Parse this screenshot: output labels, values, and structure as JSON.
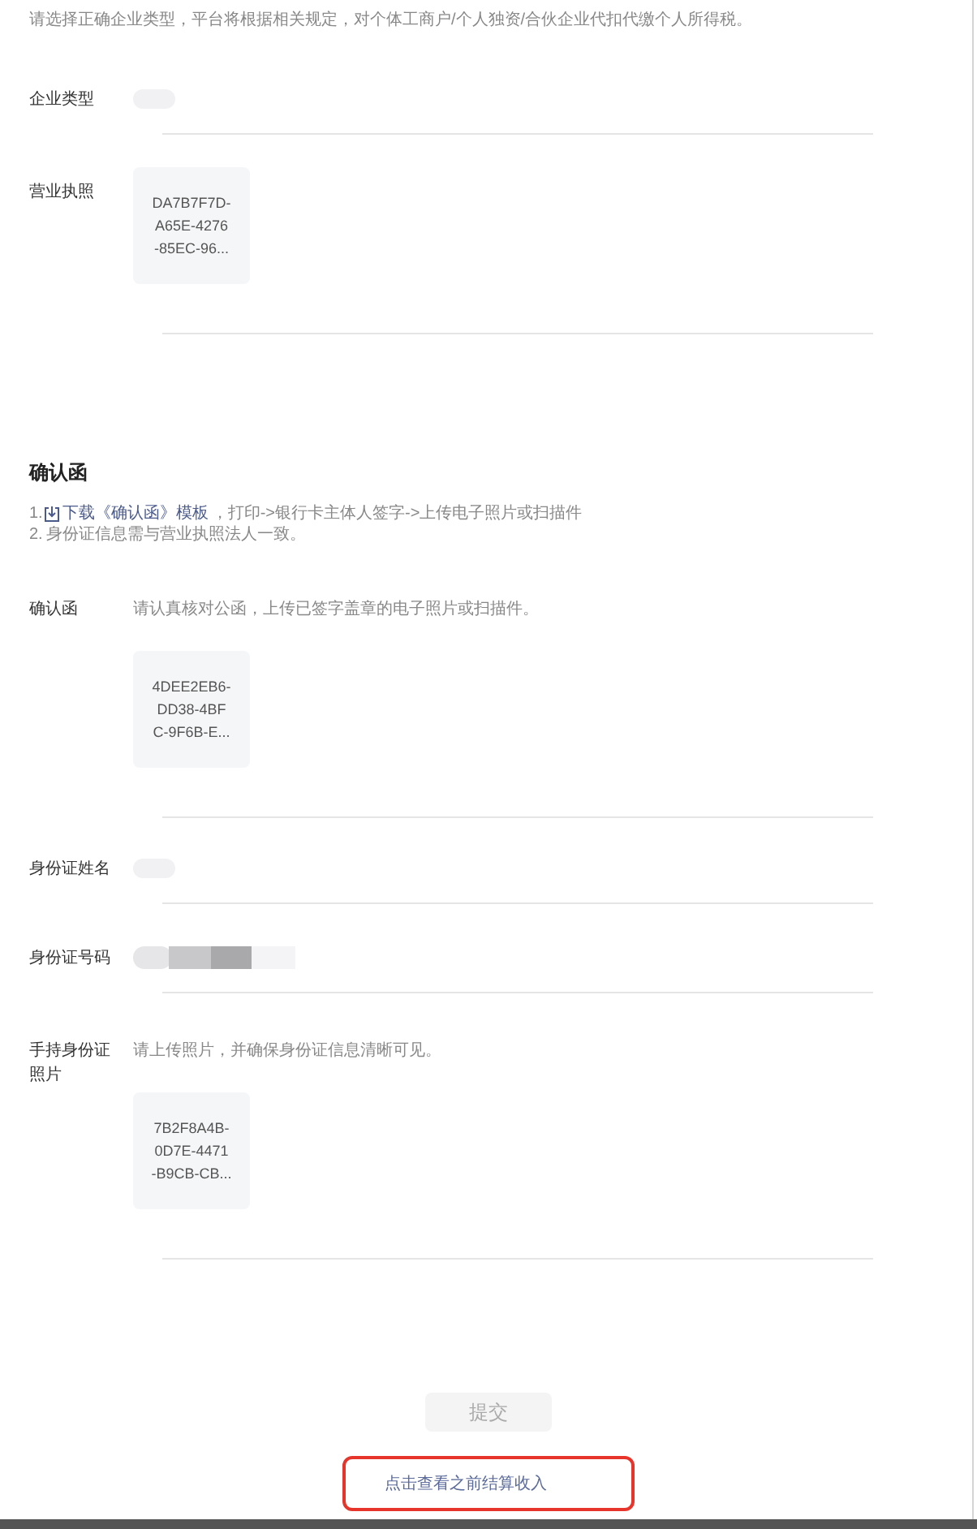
{
  "top_note": "请选择正确企业类型，平台将根据相关规定，对个体工商户/个人独资/合伙企业代扣代缴个人所得税。",
  "business_fields": [
    {
      "kind": "value",
      "label": "企业类型"
    },
    {
      "kind": "upload",
      "label": "营业执照",
      "file": "DA7B7F7D-\nA65E-4276\n-85EC-96..."
    }
  ],
  "confirmation": {
    "heading": "确认函",
    "steps": [
      {
        "prefix": "1.",
        "link": "下载《确认函》模板",
        "text": "，打印->银行卡主体人签字->上传电子照片或扫描件"
      },
      {
        "prefix": "2.",
        "text": "身份证信息需与营业执照法人一致。"
      }
    ],
    "fields": [
      {
        "kind": "upload",
        "label": "确认函",
        "hint": "请认真核对公函，上传已签字盖章的电子照片或扫描件。",
        "file": "4DEE2EB6-\nDD38-4BF\nC-9F6B-E..."
      },
      {
        "kind": "value",
        "label": "身份证姓名"
      },
      {
        "kind": "masked",
        "label": "身份证号码"
      },
      {
        "kind": "upload",
        "label": "手持身份证照片",
        "hint": "请上传照片，并确保身份证信息清晰可见。",
        "file": "7B2F8A4B-\n0D7E-4471\n-B9CB-CB..."
      }
    ]
  },
  "submit": {
    "label": "提交",
    "disabled": true
  },
  "history_link": "点击查看之前结算收入"
}
